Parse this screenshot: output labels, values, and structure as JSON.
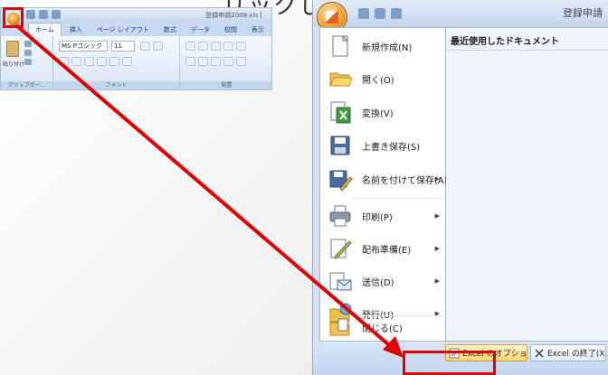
{
  "heading": {
    "text": "リックします。"
  },
  "mini_excel": {
    "doc_title": "登録申請2008.xls [",
    "tabs": [
      "ホーム",
      "挿入",
      "ページ レイアウト",
      "数式",
      "データ",
      "校閲",
      "表示"
    ],
    "font_name": "MS Pゴシック",
    "font_size": "11",
    "paste_label": "貼り付け",
    "groups": {
      "clipboard": "クリップボー…",
      "font": "フォント",
      "alignment": "配置"
    }
  },
  "office_menu": {
    "doc_title": "登録申請",
    "recent_title": "最近使用したドキュメント",
    "items": [
      {
        "label": "新規作成(N)",
        "icon": "new-document-icon",
        "submenu": false
      },
      {
        "label": "開く(O)",
        "icon": "open-folder-icon",
        "submenu": false
      },
      {
        "label": "変換(V)",
        "icon": "convert-icon",
        "submenu": false
      },
      {
        "label": "上書き保存(S)",
        "icon": "save-icon",
        "submenu": false
      },
      {
        "label": "名前を付けて保存(A)",
        "icon": "save-as-icon",
        "submenu": true
      },
      {
        "label": "印刷(P)",
        "icon": "print-icon",
        "submenu": true
      },
      {
        "label": "配布準備(E)",
        "icon": "prepare-icon",
        "submenu": true
      },
      {
        "label": "送信(D)",
        "icon": "send-icon",
        "submenu": true
      },
      {
        "label": "発行(U)",
        "icon": "publish-icon",
        "submenu": true
      },
      {
        "label": "閉じる(C)",
        "icon": "close-document-icon",
        "submenu": false
      }
    ],
    "submenu_arrow": "▶",
    "excel_options": "Excel のオプション(I)",
    "exit_excel": "Excel の終了(X)"
  },
  "colors": {
    "annotation_red": "#e00000",
    "ribbon_blue": "#dfeaf7",
    "office_orange": "#f0a030"
  }
}
